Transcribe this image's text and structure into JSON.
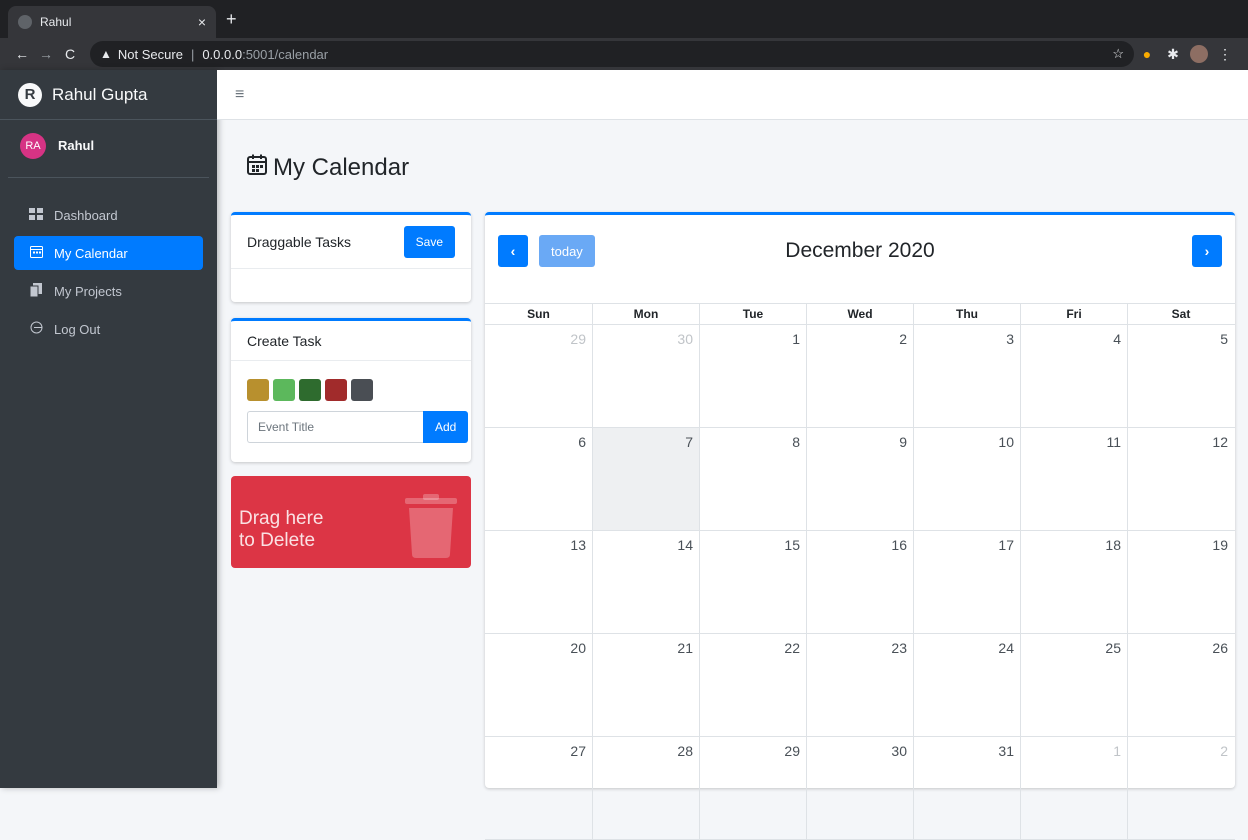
{
  "browser": {
    "tab_title": "Rahul",
    "tab_close": "×",
    "new_tab": "+",
    "security": "Not Secure",
    "url_host": "0.0.0.0",
    "url_path": ":5001/calendar"
  },
  "sidebar": {
    "brand": "Rahul Gupta",
    "brand_logo": "R",
    "user_initials": "RA",
    "user_name": "Rahul",
    "items": [
      {
        "label": "Dashboard",
        "icon": "dashboard-icon"
      },
      {
        "label": "My Calendar",
        "icon": "calendar-icon"
      },
      {
        "label": "My Projects",
        "icon": "copy-icon"
      },
      {
        "label": "Log Out",
        "icon": "logout-icon"
      }
    ]
  },
  "page": {
    "title": "My Calendar"
  },
  "draggable": {
    "title": "Draggable Tasks",
    "save_label": "Save"
  },
  "create_task": {
    "title": "Create Task",
    "colors": [
      "#b8902e",
      "#5cb85c",
      "#2e6b2e",
      "#a12b2b",
      "#4a4e54"
    ],
    "placeholder": "Event Title",
    "add_label": "Add"
  },
  "trash": {
    "line1": "Drag here",
    "line2": "to Delete"
  },
  "calendar": {
    "title": "December 2020",
    "today_label": "today",
    "days": [
      "Sun",
      "Mon",
      "Tue",
      "Wed",
      "Thu",
      "Fri",
      "Sat"
    ],
    "weeks": [
      [
        "29",
        "30",
        "1",
        "2",
        "3",
        "4",
        "5"
      ],
      [
        "6",
        "7",
        "8",
        "9",
        "10",
        "11",
        "12"
      ],
      [
        "13",
        "14",
        "15",
        "16",
        "17",
        "18",
        "19"
      ],
      [
        "20",
        "21",
        "22",
        "23",
        "24",
        "25",
        "26"
      ],
      [
        "27",
        "28",
        "29",
        "30",
        "31",
        "1",
        "2"
      ]
    ],
    "today_date": "7"
  }
}
